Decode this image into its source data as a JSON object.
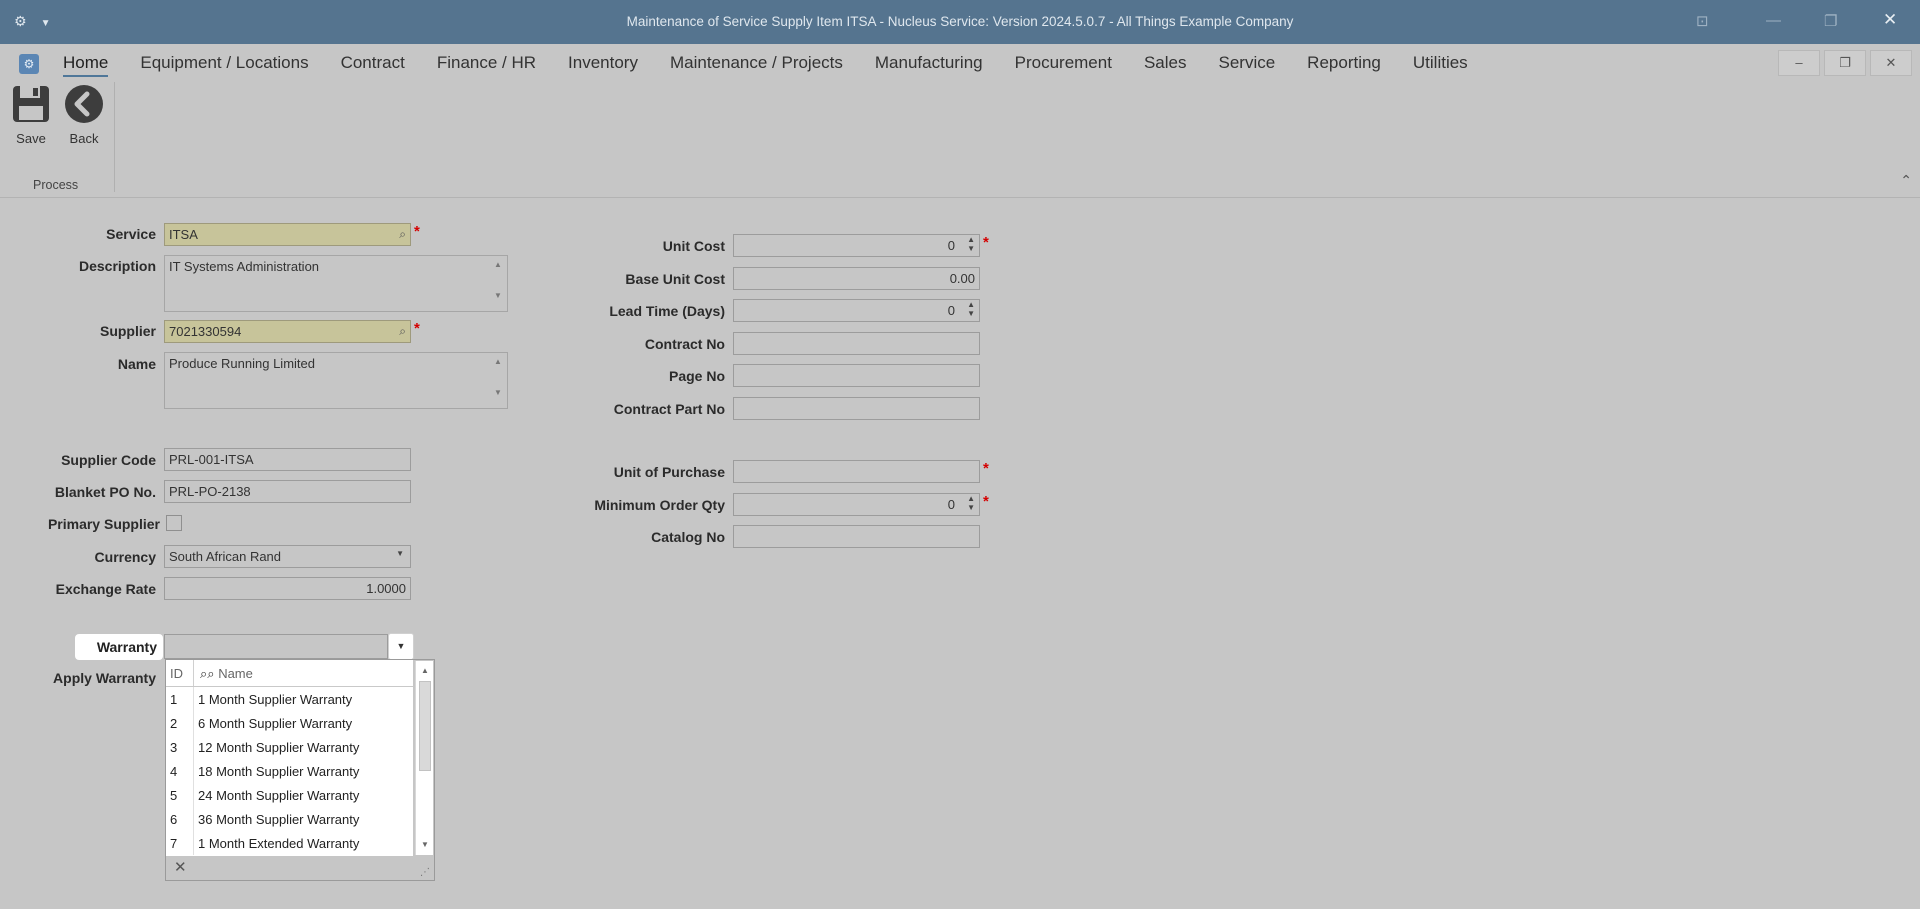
{
  "window": {
    "title": "Maintenance of Service Supply Item ITSA - Nucleus Service: Version 2024.5.0.7 - All Things Example Company"
  },
  "menu": [
    "Home",
    "Equipment / Locations",
    "Contract",
    "Finance / HR",
    "Inventory",
    "Maintenance / Projects",
    "Manufacturing",
    "Procurement",
    "Sales",
    "Service",
    "Reporting",
    "Utilities"
  ],
  "toolbar": {
    "save_label": "Save",
    "back_label": "Back",
    "group_label": "Process"
  },
  "form_left": {
    "service_label": "Service",
    "service_value": "ITSA",
    "description_label": "Description",
    "description_value": "IT Systems Administration",
    "supplier_label": "Supplier",
    "supplier_value": "7021330594",
    "name_label": "Name",
    "name_value": "Produce Running Limited",
    "supplier_code_label": "Supplier Code",
    "supplier_code_value": "PRL-001-ITSA",
    "blanket_po_label": "Blanket PO No.",
    "blanket_po_value": "PRL-PO-2138",
    "primary_supplier_label": "Primary Supplier",
    "currency_label": "Currency",
    "currency_value": "South African Rand",
    "exchange_rate_label": "Exchange Rate",
    "exchange_rate_value": "1.0000",
    "warranty_label": "Warranty",
    "warranty_value": "",
    "apply_warranty_label": "Apply Warranty"
  },
  "form_right": {
    "unit_cost_label": "Unit Cost",
    "unit_cost_value": "0",
    "base_unit_cost_label": "Base Unit Cost",
    "base_unit_cost_value": "0.00",
    "lead_time_label": "Lead Time (Days)",
    "lead_time_value": "0",
    "contract_no_label": "Contract No",
    "contract_no_value": "",
    "page_no_label": "Page No",
    "page_no_value": "",
    "contract_part_no_label": "Contract Part No",
    "contract_part_no_value": "",
    "unit_of_purchase_label": "Unit of Purchase",
    "unit_of_purchase_value": "",
    "min_order_qty_label": "Minimum Order Qty",
    "min_order_qty_value": "0",
    "catalog_no_label": "Catalog No",
    "catalog_no_value": ""
  },
  "warranty_dropdown": {
    "col_id": "ID",
    "col_name": "Name",
    "rows": [
      {
        "id": "1",
        "name": "1 Month Supplier Warranty"
      },
      {
        "id": "2",
        "name": "6 Month Supplier Warranty"
      },
      {
        "id": "3",
        "name": "12 Month Supplier Warranty"
      },
      {
        "id": "4",
        "name": "18 Month Supplier Warranty"
      },
      {
        "id": "5",
        "name": "24 Month Supplier Warranty"
      },
      {
        "id": "6",
        "name": "36 Month Supplier Warranty"
      },
      {
        "id": "7",
        "name": "1 Month Extended Warranty"
      }
    ]
  },
  "colors": {
    "titlebar": "#55748f",
    "background": "#c6c6c6",
    "required_field": "#c7c49a",
    "required_marker": "#d40000"
  }
}
